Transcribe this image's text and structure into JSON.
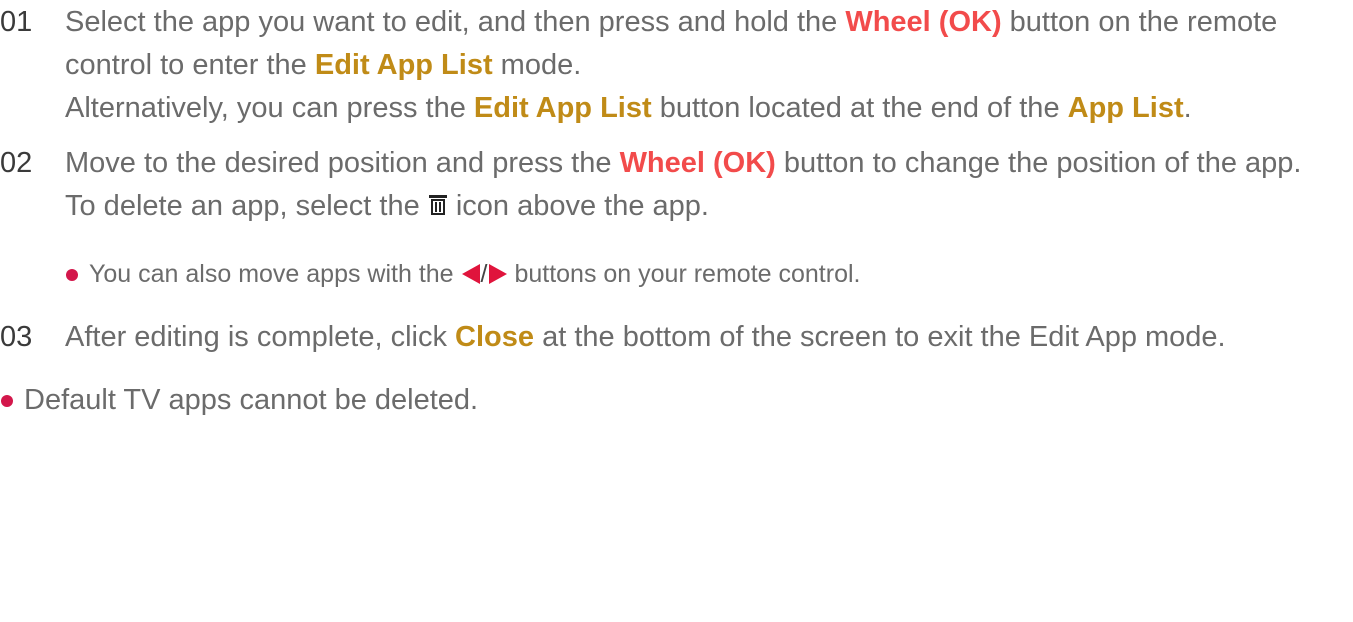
{
  "colors": {
    "text": "#6b6b6b",
    "step_number": "#3a3a3a",
    "remote_button_red": "#f24b4b",
    "ui_term_gold": "#c08b17",
    "bullet_dot": "#d3174b"
  },
  "steps": [
    {
      "number": "01",
      "line1": {
        "t1": "Select the app you want to edit, and then press and hold the ",
        "btn": "Wheel (OK)",
        "t2": " button on the remote control to enter the ",
        "term": "Edit App List",
        "t3": " mode."
      },
      "line2": {
        "t1": "Alternatively, you can press the ",
        "term1": "Edit App List",
        "t2": " button located at the end of the ",
        "term2": "App List",
        "t3": "."
      }
    },
    {
      "number": "02",
      "line1": {
        "t1": "Move to the desired position and press the ",
        "btn": "Wheel (OK)",
        "t2": " button to change the position of the app."
      },
      "line2": {
        "t1": "To delete an app, select the ",
        "icon": "trash-icon",
        "t2": " icon above the app."
      },
      "bullet": {
        "t1": "You can also move apps with the ",
        "icon_left": "left-arrow-icon",
        "sep": "/",
        "icon_right": "right-arrow-icon",
        "t2": " buttons on your remote control."
      }
    },
    {
      "number": "03",
      "line1": {
        "t1": "After editing is complete, click ",
        "term": "Close",
        "t2": " at the bottom of the screen to exit the Edit App mode."
      }
    }
  ],
  "note": {
    "text": "Default TV apps cannot be deleted."
  }
}
